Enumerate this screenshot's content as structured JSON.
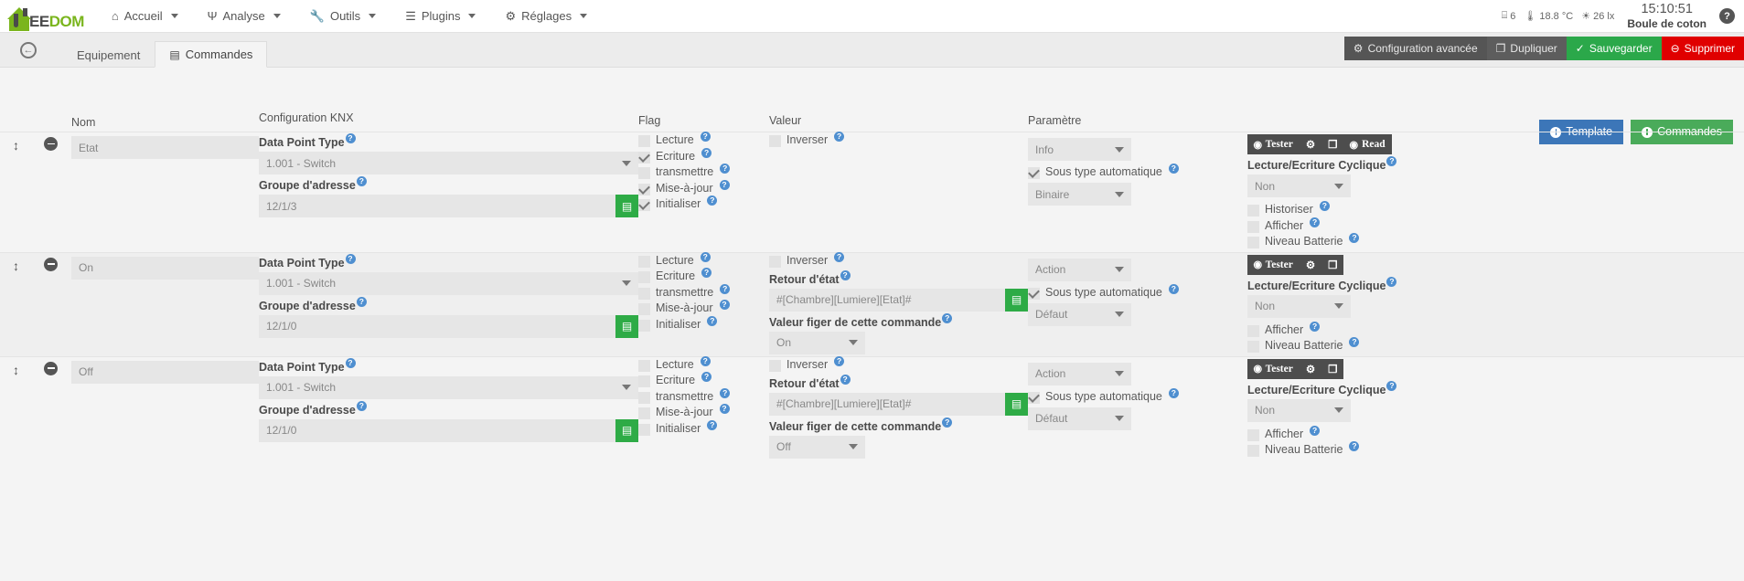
{
  "navbar": {
    "brand": {
      "ee": "EE",
      "dom": "DOM"
    },
    "items": [
      {
        "label": "Accueil",
        "icon": "home-icon",
        "glyph": "⌂",
        "caret": true
      },
      {
        "label": "Analyse",
        "icon": "analyse-icon",
        "glyph": "Ψ",
        "caret": true
      },
      {
        "label": "Outils",
        "icon": "wrench-icon",
        "glyph": "🔧",
        "caret": true
      },
      {
        "label": "Plugins",
        "icon": "list-icon",
        "glyph": "☰",
        "caret": true
      },
      {
        "label": "Réglages",
        "icon": "gear-icon",
        "glyph": "⚙",
        "caret": true
      }
    ],
    "sensors": [
      {
        "icon": "window-icon",
        "glyph": "⌸",
        "value": "6"
      },
      {
        "icon": "thermometer-icon",
        "glyph": "🌡",
        "value": "18.8 °C"
      },
      {
        "icon": "sun-icon",
        "glyph": "☀",
        "value": "26 lx"
      }
    ],
    "clock": "15:10:51",
    "username": "Boule de coton",
    "help": "?"
  },
  "tabbar": {
    "back": "←",
    "tabs": [
      {
        "label": "Equipement",
        "icon": null,
        "active": false
      },
      {
        "label": "Commandes",
        "icon": "table-icon",
        "glyph": "▤",
        "active": true
      }
    ],
    "buttons": [
      {
        "label": "Configuration avancée",
        "icon": "gears-icon",
        "glyph": "⚙",
        "style": "dark"
      },
      {
        "label": "Dupliquer",
        "icon": "copy-icon",
        "glyph": "❐",
        "style": "dark2"
      },
      {
        "label": "Sauvegarder",
        "icon": "check-circle-icon",
        "glyph": "✓",
        "style": "green"
      },
      {
        "label": "Supprimer",
        "icon": "minus-circle-icon",
        "glyph": "⊖",
        "style": "red"
      }
    ]
  },
  "top_buttons": [
    {
      "label": "Template",
      "icon": "plus-circle-icon",
      "style": "blue"
    },
    {
      "label": "Commandes",
      "icon": "plus-circle-icon",
      "style": "green"
    }
  ],
  "columns": {
    "nom": "Nom",
    "knx": "Configuration KNX",
    "flag": "Flag",
    "valeur": "Valeur",
    "parametre": "Paramètre"
  },
  "labels": {
    "data_point_type": "Data Point Type",
    "groupe_adresse": "Groupe d'adresse",
    "retour_etat": "Retour d'état",
    "valeur_figer": "Valeur figer de cette commande",
    "cyclique": "Lecture/Ecriture Cyclique",
    "sous_type_auto": "Sous type automatique",
    "inverser": "Inverser",
    "lecture": "Lecture",
    "ecriture": "Ecriture",
    "transmettre": "transmettre",
    "mise_a_jour": "Mise-à-jour",
    "initialiser": "Initialiser",
    "historiser": "Historiser",
    "afficher": "Afficher",
    "niveau_batterie": "Niveau Batterie",
    "help_glyph": "?"
  },
  "action_bar": {
    "tester": "Tester",
    "read": "Read",
    "config_icon": "gears-icon",
    "copy_icon": "copy-icon"
  },
  "rows": [
    {
      "nom": "Etat",
      "dpt": "1.001 - Switch",
      "groupe": "12/1/3",
      "flags": [
        {
          "label": "Lecture",
          "checked": false
        },
        {
          "label": "Ecriture",
          "checked": true
        },
        {
          "label": "transmettre",
          "checked": false
        },
        {
          "label": "Mise-à-jour",
          "checked": true
        },
        {
          "label": "Initialiser",
          "checked": true
        }
      ],
      "inverser": false,
      "has_retour": false,
      "retour_value": "",
      "has_figer": false,
      "figer_value": "",
      "param_type": "Info",
      "sous_type_auto": true,
      "sous_type": "Binaire",
      "has_read": true,
      "cyclique": "Non",
      "act_checks": [
        {
          "label": "Historiser",
          "checked": false
        },
        {
          "label": "Afficher",
          "checked": false
        },
        {
          "label": "Niveau Batterie",
          "checked": false
        }
      ]
    },
    {
      "nom": "On",
      "dpt": "1.001 - Switch",
      "groupe": "12/1/0",
      "flags": [
        {
          "label": "Lecture",
          "checked": false
        },
        {
          "label": "Ecriture",
          "checked": false
        },
        {
          "label": "transmettre",
          "checked": false
        },
        {
          "label": "Mise-à-jour",
          "checked": false
        },
        {
          "label": "Initialiser",
          "checked": false
        }
      ],
      "inverser": false,
      "has_retour": true,
      "retour_value": "#[Chambre][Lumiere][Etat]#",
      "has_figer": true,
      "figer_value": "On",
      "param_type": "Action",
      "sous_type_auto": true,
      "sous_type": "Défaut",
      "has_read": false,
      "cyclique": "Non",
      "act_checks": [
        {
          "label": "Afficher",
          "checked": false
        },
        {
          "label": "Niveau Batterie",
          "checked": false
        }
      ]
    },
    {
      "nom": "Off",
      "dpt": "1.001 - Switch",
      "groupe": "12/1/0",
      "flags": [
        {
          "label": "Lecture",
          "checked": false
        },
        {
          "label": "Ecriture",
          "checked": false
        },
        {
          "label": "transmettre",
          "checked": false
        },
        {
          "label": "Mise-à-jour",
          "checked": false
        },
        {
          "label": "Initialiser",
          "checked": false
        }
      ],
      "inverser": false,
      "has_retour": true,
      "retour_value": "#[Chambre][Lumiere][Etat]#",
      "has_figer": true,
      "figer_value": "Off",
      "param_type": "Action",
      "sous_type_auto": true,
      "sous_type": "Défaut",
      "has_read": false,
      "cyclique": "Non",
      "act_checks": [
        {
          "label": "Afficher",
          "checked": false
        },
        {
          "label": "Niveau Batterie",
          "checked": false
        }
      ]
    }
  ],
  "colors": {
    "brand_green": "#7ab51d",
    "save_green": "#2ba84a",
    "delete_red": "#e00000",
    "template_blue": "#3c76b8",
    "help_blue": "#4f8fd0"
  }
}
